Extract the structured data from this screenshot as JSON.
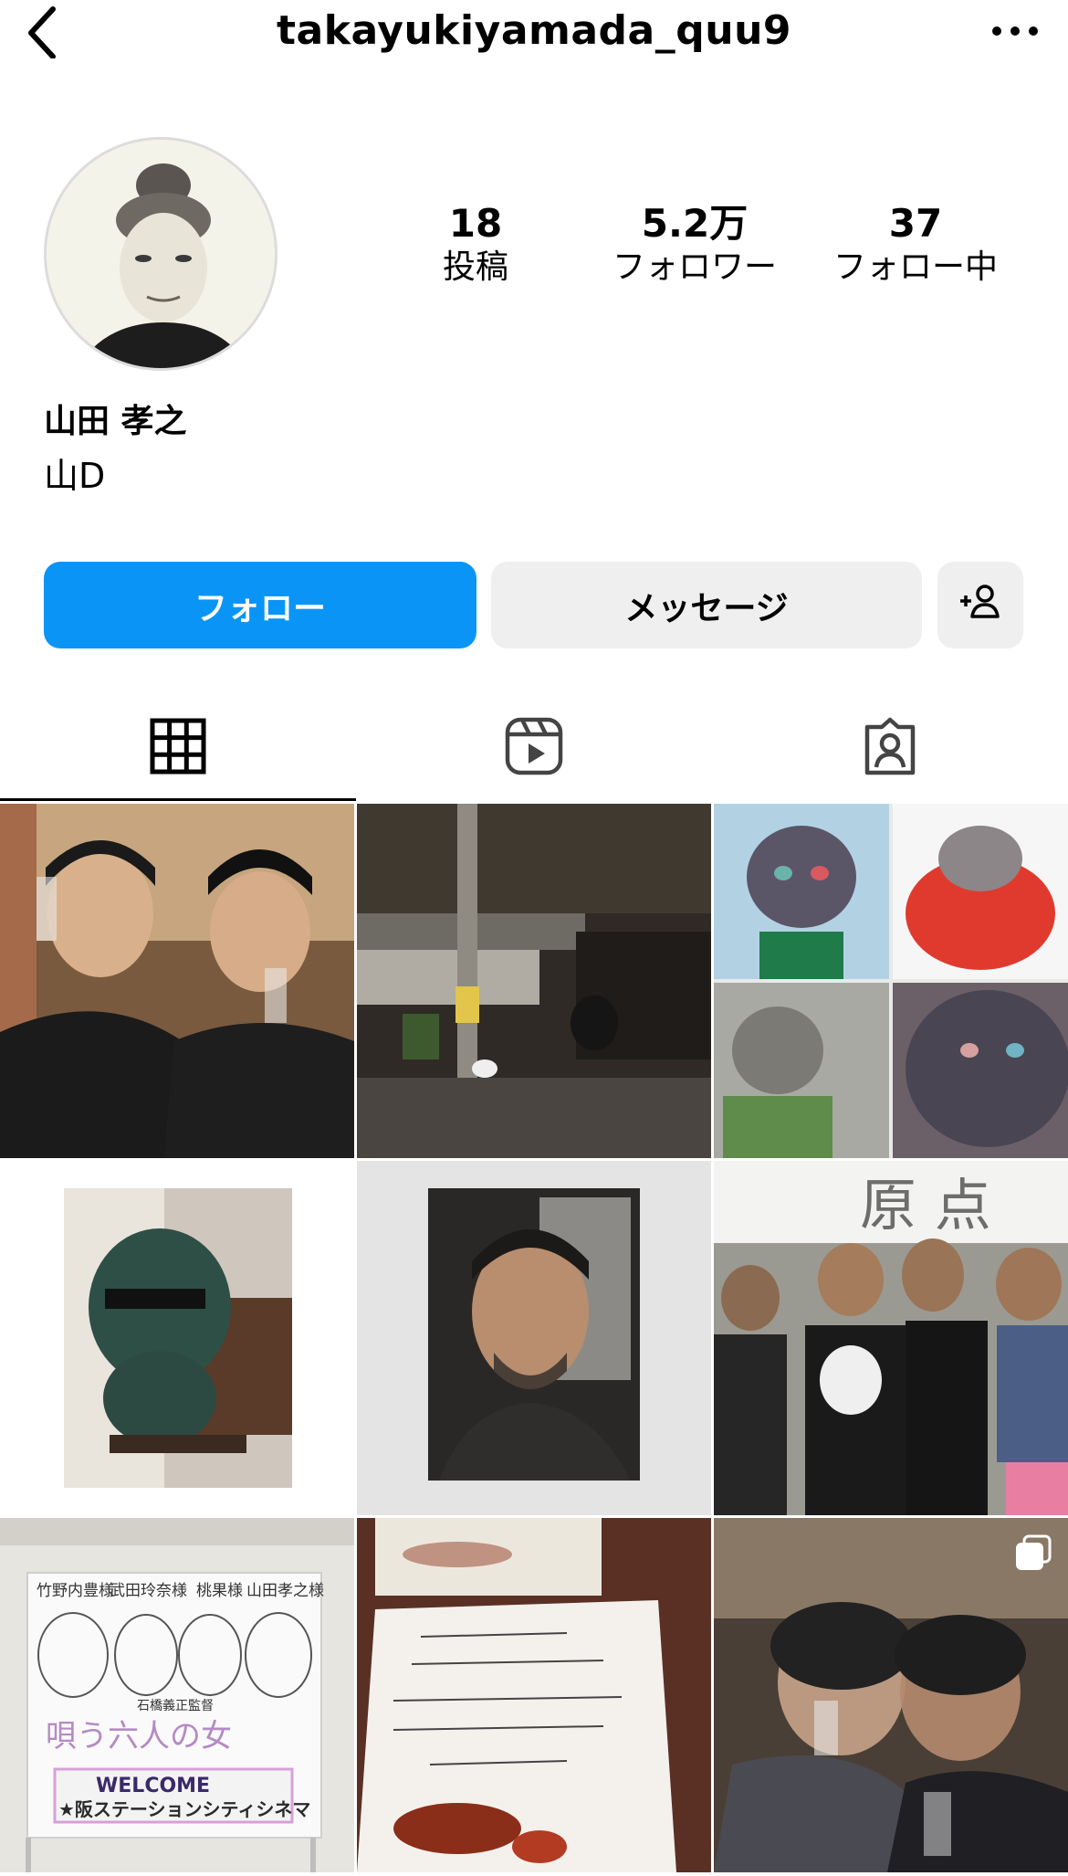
{
  "header": {
    "username": "takayukiyamada_quu9"
  },
  "stats": [
    {
      "value": "18",
      "label": "投稿"
    },
    {
      "value": "5.2万",
      "label": "フォロワー"
    },
    {
      "value": "37",
      "label": "フォロー中"
    }
  ],
  "profile": {
    "full_name": "山田 孝之",
    "bio": "山D"
  },
  "buttons": {
    "follow": "フォロー",
    "message": "メッセージ"
  },
  "tabs": [
    {
      "name": "grid-icon",
      "active": true
    },
    {
      "name": "reels-icon",
      "active": false
    },
    {
      "name": "tagged-icon",
      "active": false
    }
  ],
  "posts": {
    "poster": {
      "names": [
        "竹野内豊様",
        "武田玲奈様",
        "桃果様",
        "山田孝之様"
      ],
      "director": "石橋義正監督",
      "title": "唄う六人の女",
      "welcome": "WELCOME",
      "venue": "★阪ステーションシティシネマ"
    },
    "banner_text": "原 点"
  },
  "colors": {
    "accent": "#0a95f6",
    "button_gray": "#efefef"
  }
}
